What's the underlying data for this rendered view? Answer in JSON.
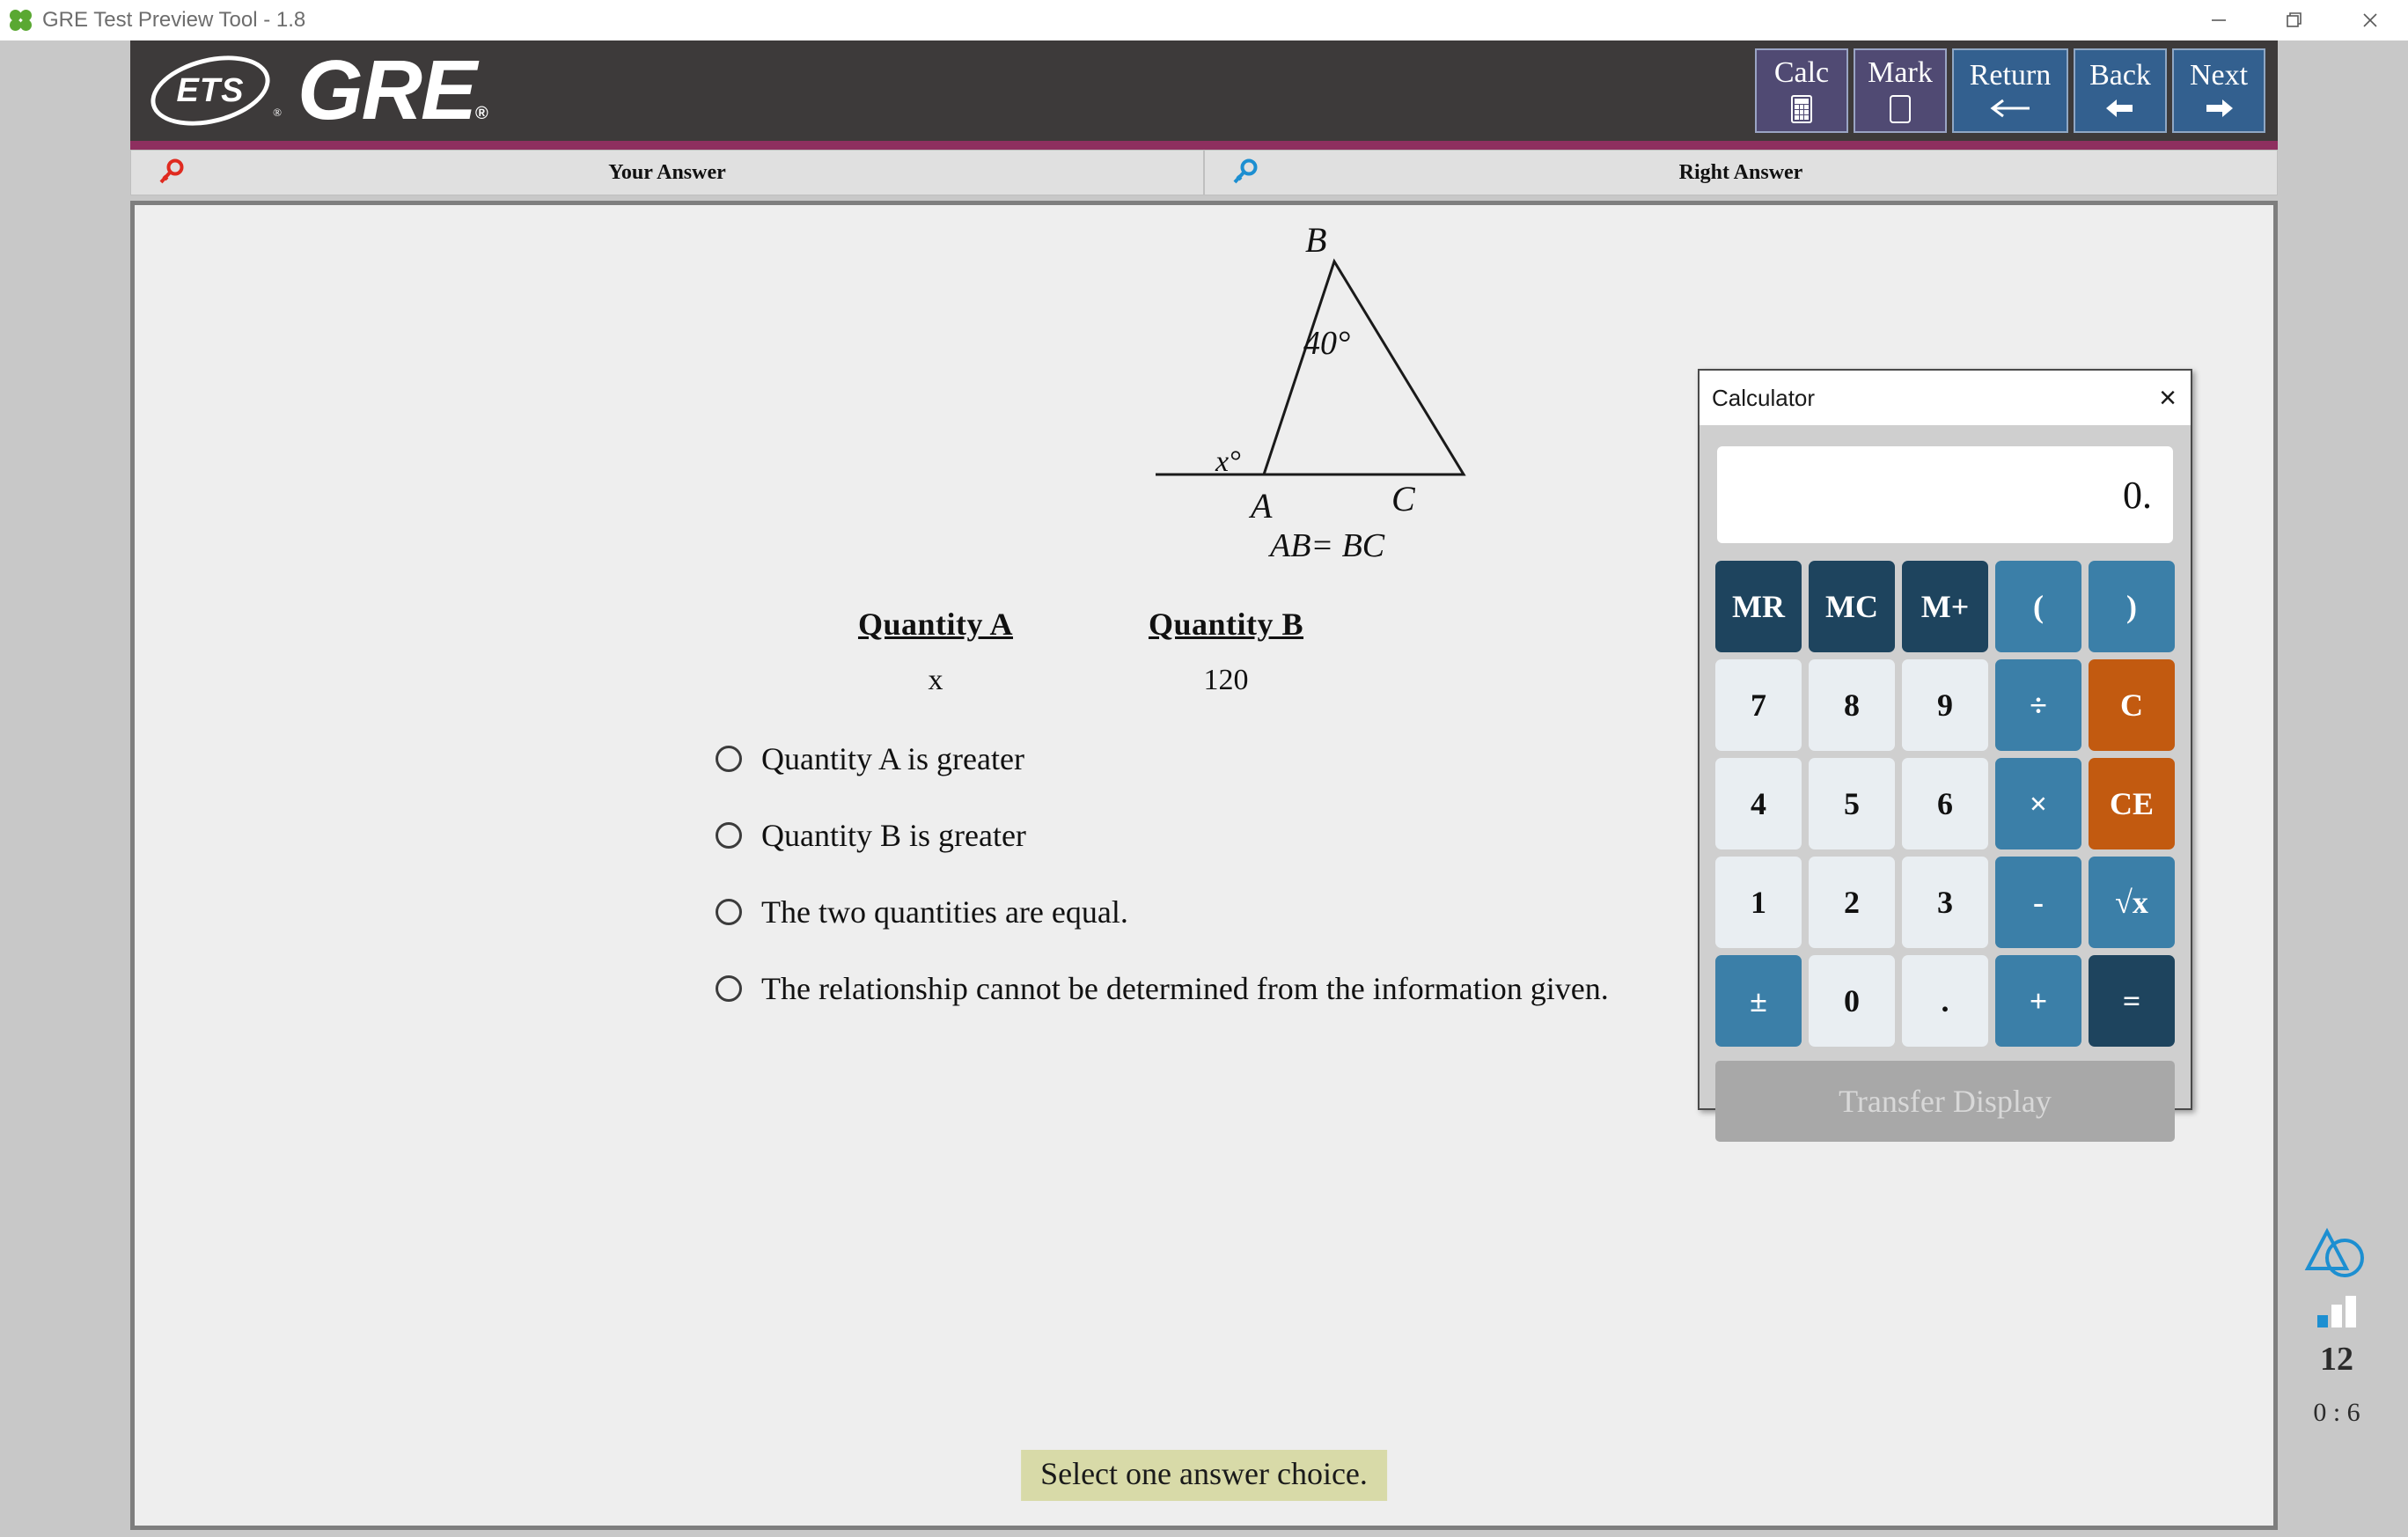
{
  "window": {
    "title": "GRE Test Preview Tool - 1.8",
    "app_icon": "clover-icon",
    "controls": {
      "minimize": "minimize-icon",
      "restore": "restore-icon",
      "close": "close-icon"
    }
  },
  "header": {
    "logo_text": "ETS",
    "logo_reg": "®",
    "brand": "GRE",
    "brand_reg": "®",
    "toolbar": [
      {
        "label": "Calc",
        "icon": "calculator-icon",
        "style": "purple"
      },
      {
        "label": "Mark",
        "icon": "bookmark-square-icon",
        "style": "purple"
      },
      {
        "label": "Return",
        "icon": "arrow-left-long-icon",
        "style": "blue"
      },
      {
        "label": "Back",
        "icon": "arrow-left-icon",
        "style": "blue"
      },
      {
        "label": "Next",
        "icon": "arrow-right-icon",
        "style": "blue"
      }
    ]
  },
  "answer_bar": {
    "your_answer": {
      "label": "Your Answer",
      "icon": "key-icon",
      "color": "#e02b20"
    },
    "right_answer": {
      "label": "Right Answer",
      "icon": "key-icon",
      "color": "#1d8fd1"
    }
  },
  "figure": {
    "vertex_b": "B",
    "vertex_a": "A",
    "vertex_c": "C",
    "angle_b": "40°",
    "angle_x": "x°",
    "caption": "AB= BC"
  },
  "question": {
    "quantity_a": {
      "heading": "Quantity A",
      "value": "x"
    },
    "quantity_b": {
      "heading": "Quantity B",
      "value": "120"
    },
    "choices": [
      "Quantity A is greater",
      "Quantity B is greater",
      "The two quantities are equal.",
      "The relationship cannot be determined from the information given."
    ],
    "instruction": "Select one answer choice."
  },
  "right_rail": {
    "shape_icon": "triangle-circle-icon",
    "bars_icon": "bar-progress-icon",
    "question_number": "12",
    "timer": "0 : 6"
  },
  "calculator": {
    "title": "Calculator",
    "close": "×",
    "display": "0.",
    "transfer_label": "Transfer Display",
    "keys": [
      {
        "label": "MR",
        "style": "navy"
      },
      {
        "label": "MC",
        "style": "navy"
      },
      {
        "label": "M+",
        "style": "navy"
      },
      {
        "label": "(",
        "style": "blue"
      },
      {
        "label": ")",
        "style": "blue"
      },
      {
        "label": "7",
        "style": "light"
      },
      {
        "label": "8",
        "style": "light"
      },
      {
        "label": "9",
        "style": "light"
      },
      {
        "label": "÷",
        "style": "blue"
      },
      {
        "label": "C",
        "style": "orange"
      },
      {
        "label": "4",
        "style": "light"
      },
      {
        "label": "5",
        "style": "light"
      },
      {
        "label": "6",
        "style": "light"
      },
      {
        "label": "×",
        "style": "blue"
      },
      {
        "label": "CE",
        "style": "orange"
      },
      {
        "label": "1",
        "style": "light"
      },
      {
        "label": "2",
        "style": "light"
      },
      {
        "label": "3",
        "style": "light"
      },
      {
        "label": "-",
        "style": "blue"
      },
      {
        "label": "√x",
        "style": "blue"
      },
      {
        "label": "±",
        "style": "blue"
      },
      {
        "label": "0",
        "style": "light"
      },
      {
        "label": ".",
        "style": "light"
      },
      {
        "label": "+",
        "style": "blue"
      },
      {
        "label": "=",
        "style": "navy"
      }
    ]
  }
}
